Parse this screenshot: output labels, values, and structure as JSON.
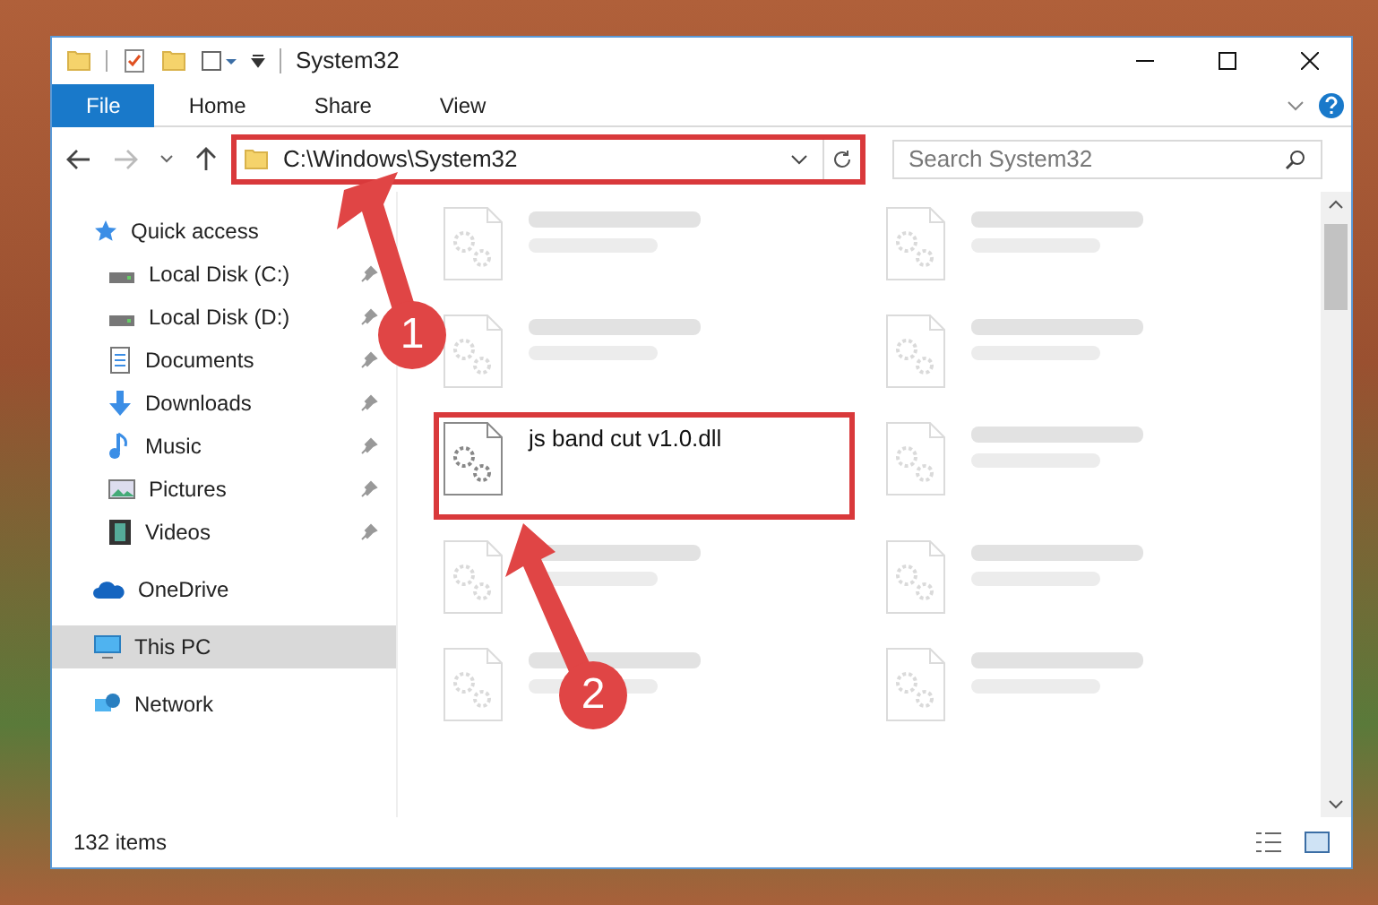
{
  "window": {
    "title": "System32"
  },
  "ribbon_tabs": [
    {
      "label": "File",
      "kind": "file",
      "selected": false
    },
    {
      "label": "Home",
      "kind": "tab",
      "selected": false
    },
    {
      "label": "Share",
      "kind": "tab",
      "selected": false
    },
    {
      "label": "View",
      "kind": "tab",
      "selected": false
    }
  ],
  "address": {
    "path": "C:\\Windows\\System32"
  },
  "search": {
    "placeholder": "Search System32"
  },
  "nav": [
    {
      "label": "Quick access",
      "selected": false,
      "children": [
        {
          "label": "Local Disk (C:)",
          "pinned": true
        },
        {
          "label": "Local Disk (D:)",
          "pinned": true
        },
        {
          "label": "Documents",
          "pinned": true
        },
        {
          "label": "Downloads",
          "pinned": true
        },
        {
          "label": "Music",
          "pinned": true
        },
        {
          "label": "Pictures",
          "pinned": true
        },
        {
          "label": "Videos",
          "pinned": true
        }
      ]
    },
    {
      "label": "OneDrive",
      "selected": false
    },
    {
      "label": "This PC",
      "selected": true
    },
    {
      "label": "Network",
      "selected": false
    }
  ],
  "files": [
    {
      "blurred": true
    },
    {
      "blurred": true
    },
    {
      "blurred": true
    },
    {
      "blurred": true
    },
    {
      "name": "js band cut v1.0.dll",
      "blurred": false
    },
    {
      "blurred": true
    },
    {
      "blurred": true
    },
    {
      "blurred": true
    },
    {
      "blurred": true
    },
    {
      "blurred": true
    }
  ],
  "status_bar": {
    "count": "132 items"
  },
  "callouts": [
    {
      "number": "1"
    },
    {
      "number": "2"
    }
  ]
}
